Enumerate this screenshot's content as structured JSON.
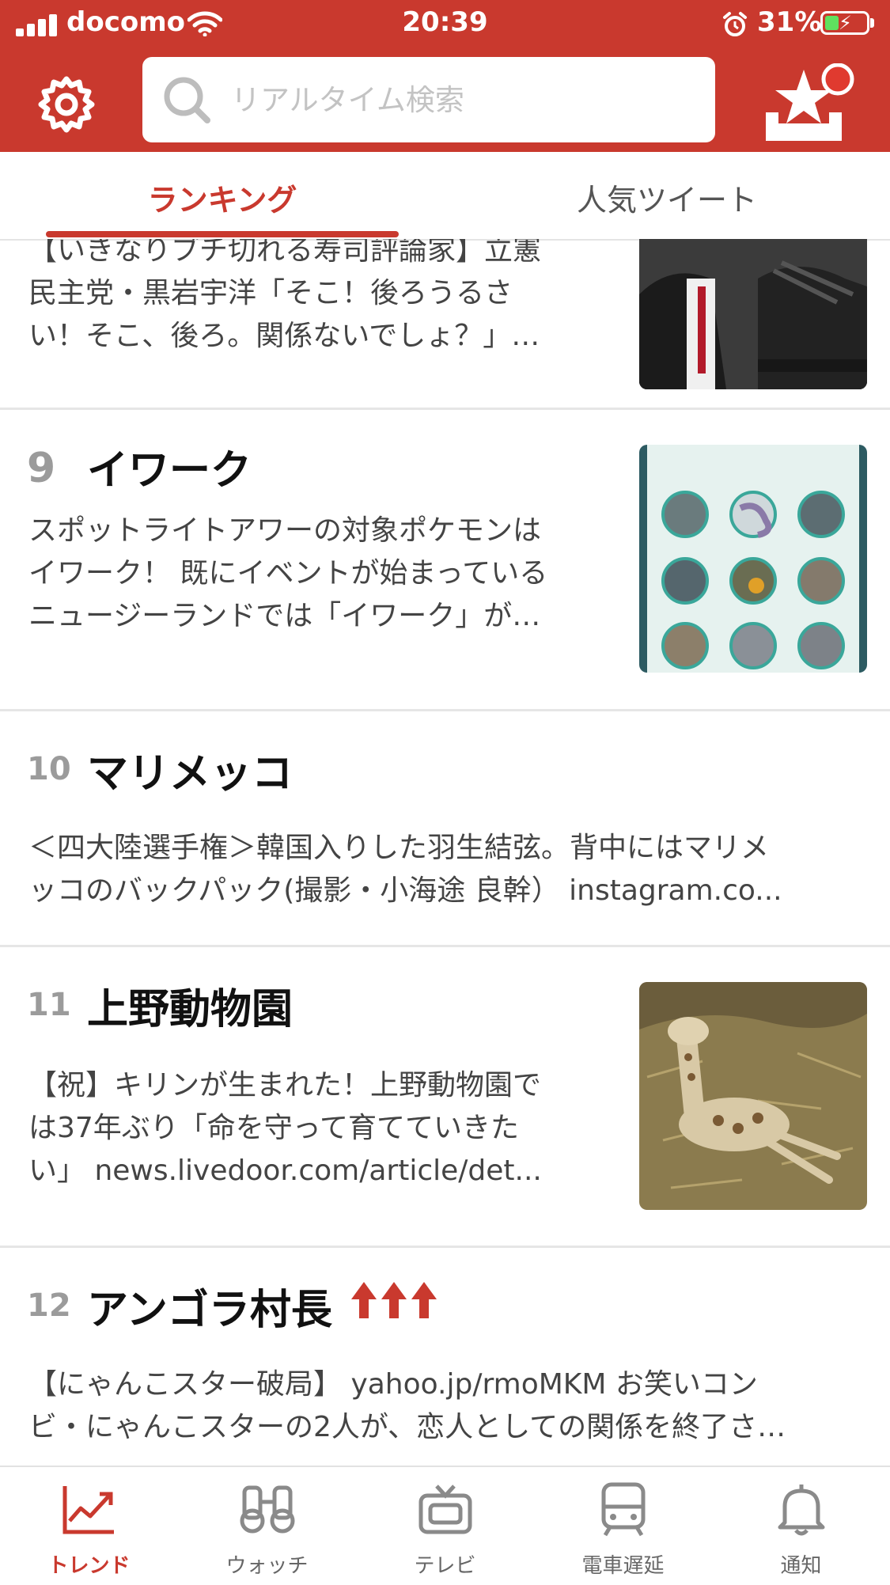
{
  "status_bar": {
    "carrier": "docomo",
    "time": "20:39",
    "battery": "31%"
  },
  "header": {
    "search_placeholder": "リアルタイム検索",
    "colors": {
      "brand": "#c9392e"
    }
  },
  "tabs": [
    {
      "label": "ランキング",
      "active": true
    },
    {
      "label": "人気ツイート",
      "active": false
    }
  ],
  "items": [
    {
      "rank": "",
      "title": "",
      "description_lines": [
        "【いきなりブチ切れる寿司評論家】立憲",
        "民主党・黒岩宇洋「そこ！後ろうるさ",
        "い！そこ、後ろ。関係ないでしょ？」…"
      ],
      "thumbnail": "parliament-photo"
    },
    {
      "rank": "9",
      "title": "イワーク",
      "description_lines": [
        "スポットライトアワーの対象ポケモンは",
        "イワーク！ 既にイベントが始まっている",
        "ニュージーランドでは「イワーク」が…"
      ],
      "thumbnail": "pokemon-grid"
    },
    {
      "rank": "10",
      "title": "マリメッコ",
      "description_lines": [
        "＜四大陸選手権＞韓国入りした羽生結弦。背中にはマリメ",
        "ッコのバックパック(撮影・小海途 良幹）  instagram.co..."
      ],
      "thumbnail": null
    },
    {
      "rank": "11",
      "title": "上野動物園",
      "description_lines": [
        "【祝】キリンが生まれた！上野動物園で",
        "は37年ぶり「命を守って育てていきた",
        "い」 news.livedoor.com/article/det..."
      ],
      "thumbnail": "giraffe-photo"
    },
    {
      "rank": "12",
      "title": "アンゴラ村長",
      "description_lines": [
        "【にゃんこスター破局】 yahoo.jp/rmoMKM  お笑いコン",
        "ビ・にゃんこスターの2人が、恋人としての関係を終了さ…"
      ],
      "thumbnail": null,
      "trend_icon": "triple-up-arrow-icon"
    }
  ],
  "bottom_nav": [
    {
      "label": "トレンド",
      "icon": "trend-chart-icon",
      "active": true
    },
    {
      "label": "ウォッチ",
      "icon": "binoculars-icon",
      "active": false
    },
    {
      "label": "テレビ",
      "icon": "tv-icon",
      "active": false
    },
    {
      "label": "電車遅延",
      "icon": "train-icon",
      "active": false
    },
    {
      "label": "通知",
      "icon": "bell-icon",
      "active": false
    }
  ]
}
